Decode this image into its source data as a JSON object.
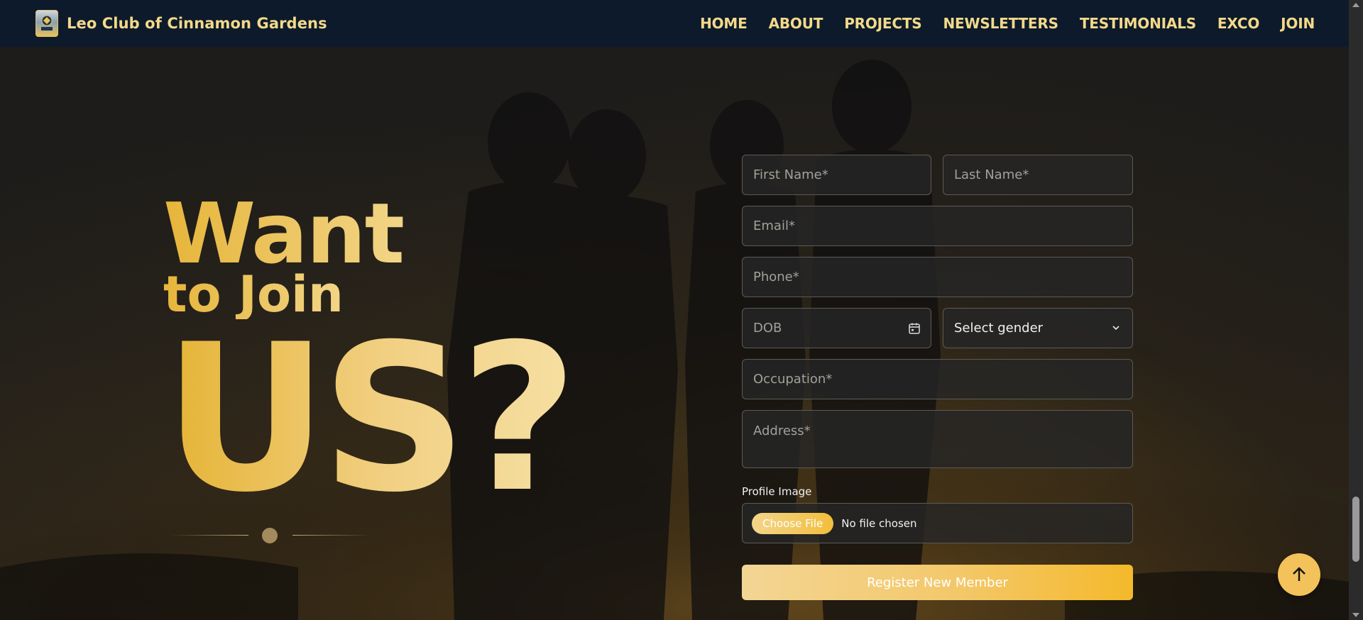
{
  "navbar": {
    "brand_name": "Leo Club of Cinnamon Gardens",
    "logo_icon": "club-crest-icon",
    "links": [
      "HOME",
      "ABOUT",
      "PROJECTS",
      "NEWSLETTERS",
      "TESTIMONIALS",
      "EXCO",
      "JOIN"
    ]
  },
  "hero": {
    "line1": "Want",
    "line2": "to Join",
    "line3": "US?"
  },
  "form": {
    "first_name_placeholder": "First Name*",
    "last_name_placeholder": "Last Name*",
    "email_placeholder": "Email*",
    "phone_placeholder": "Phone*",
    "dob_placeholder": "DOB",
    "gender_selected": "Select gender",
    "occupation_placeholder": "Occupation*",
    "address_placeholder": "Address*",
    "profile_image_label": "Profile Image",
    "choose_file_label": "Choose File",
    "file_status": "No file chosen",
    "submit_label": "Register New Member"
  },
  "scroll_top": {
    "icon": "arrow-up-icon"
  },
  "colors": {
    "navbar_bg": "#0d1a2b",
    "accent_gold": "#f3d98a",
    "button_gold": "#f4b92b"
  }
}
